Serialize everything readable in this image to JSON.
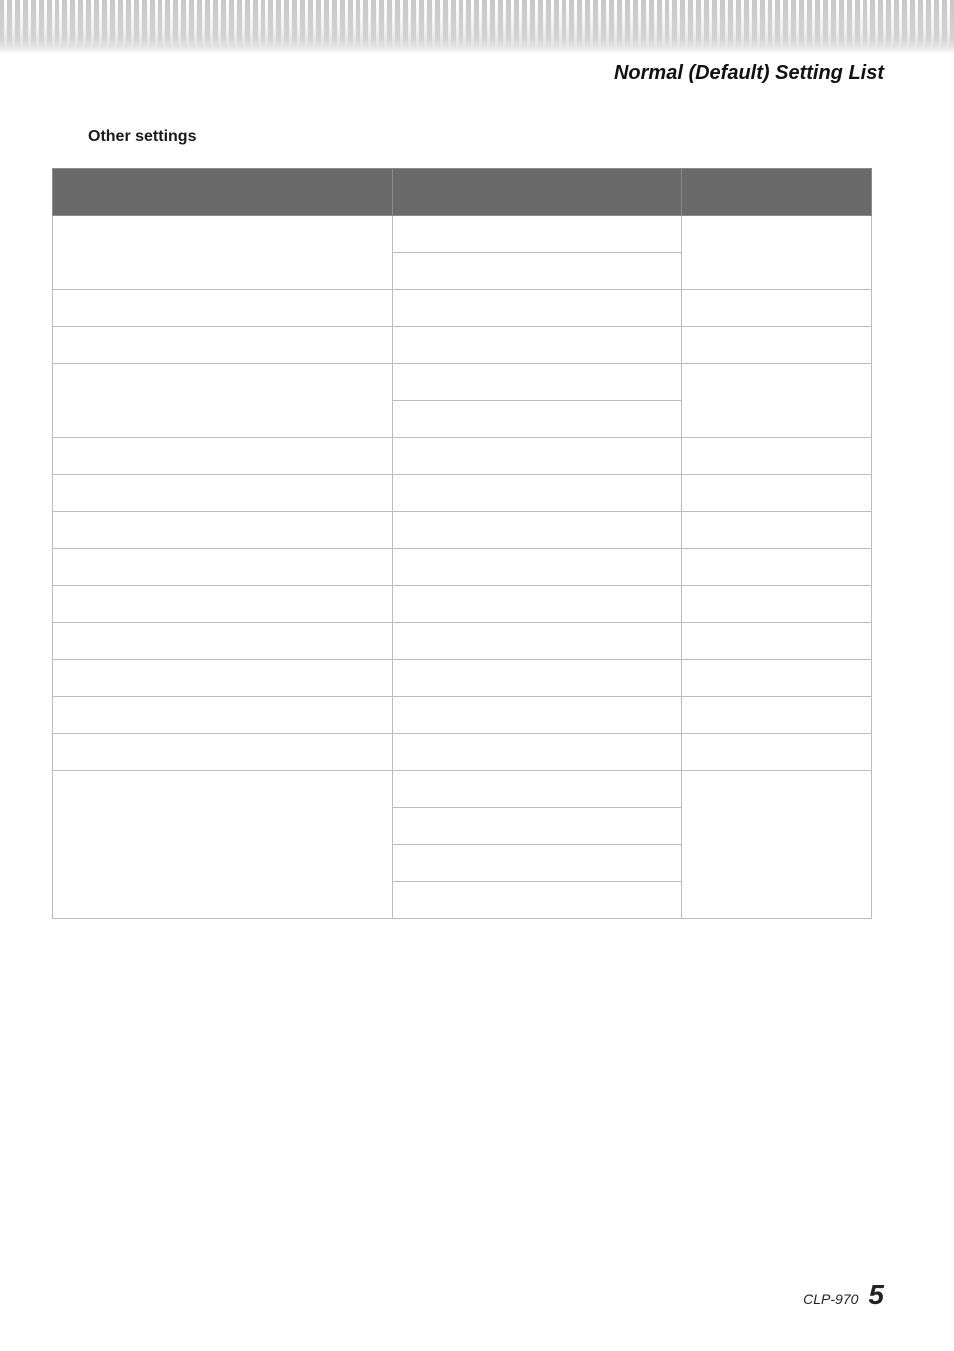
{
  "header": {
    "page_title": "Normal (Default) Setting List"
  },
  "section": {
    "title": "Other settings"
  },
  "table": {
    "columns": [
      "",
      "",
      ""
    ],
    "rows": [
      {
        "name": "",
        "default": [
          "",
          ""
        ],
        "backup": ""
      },
      {
        "name": "",
        "default": [
          ""
        ],
        "backup": ""
      },
      {
        "name": "",
        "default": [
          ""
        ],
        "backup": ""
      },
      {
        "name": "",
        "default": [
          "",
          ""
        ],
        "backup": ""
      },
      {
        "name": "",
        "default": [
          ""
        ],
        "backup": ""
      },
      {
        "name": "",
        "default": [
          ""
        ],
        "backup": ""
      },
      {
        "name": "",
        "default": [
          ""
        ],
        "backup": ""
      },
      {
        "name": "",
        "default": [
          ""
        ],
        "backup": ""
      },
      {
        "name": "",
        "default": [
          ""
        ],
        "backup": ""
      },
      {
        "name": "",
        "default": [
          ""
        ],
        "backup": ""
      },
      {
        "name": "",
        "default": [
          ""
        ],
        "backup": ""
      },
      {
        "name": "",
        "default": [
          ""
        ],
        "backup": ""
      },
      {
        "name": "",
        "default": [
          ""
        ],
        "backup": ""
      },
      {
        "name": "",
        "default": [
          "",
          "",
          "",
          ""
        ],
        "backup": ""
      }
    ]
  },
  "footer": {
    "model": "CLP-970",
    "page_number": "5"
  }
}
